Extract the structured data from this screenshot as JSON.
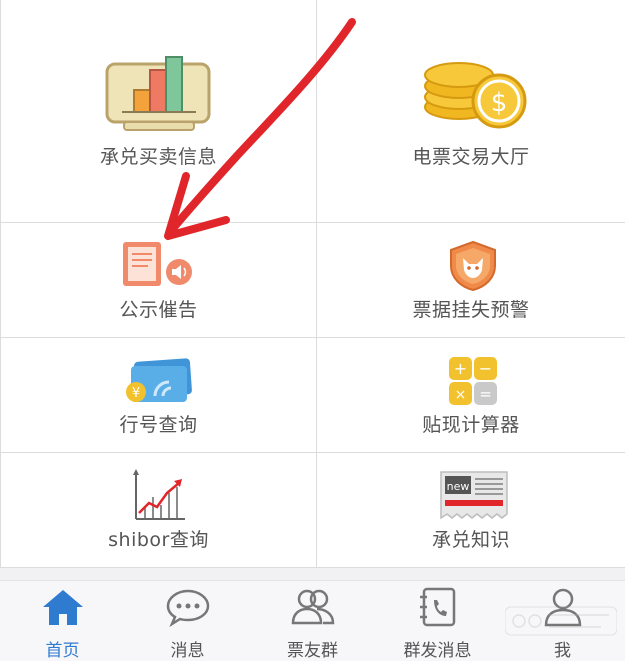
{
  "grid": {
    "items": [
      {
        "label": "承兑买卖信息",
        "icon": "bar-chart-board-icon"
      },
      {
        "label": "电票交易大厅",
        "icon": "gold-coins-icon"
      },
      {
        "label": "公示催告",
        "icon": "notice-board-speaker-icon"
      },
      {
        "label": "票据挂失预警",
        "icon": "shield-fox-icon"
      },
      {
        "label": "行号查询",
        "icon": "bank-cards-icon"
      },
      {
        "label": "贴现计算器",
        "icon": "calculator-icon"
      },
      {
        "label": "shibor查询",
        "icon": "trend-chart-icon"
      },
      {
        "label": "承兑知识",
        "icon": "news-paper-icon"
      }
    ]
  },
  "tabbar": {
    "tabs": [
      {
        "label": "首页",
        "icon": "home-icon",
        "active": true
      },
      {
        "label": "消息",
        "icon": "chat-bubble-icon",
        "active": false
      },
      {
        "label": "票友群",
        "icon": "group-icon",
        "active": false
      },
      {
        "label": "群发消息",
        "icon": "contact-book-icon",
        "active": false
      },
      {
        "label": "我",
        "icon": "user-icon",
        "active": false
      }
    ]
  },
  "colors": {
    "active": "#2f7bd0",
    "annotation": "#e0262b",
    "label": "#555555"
  }
}
